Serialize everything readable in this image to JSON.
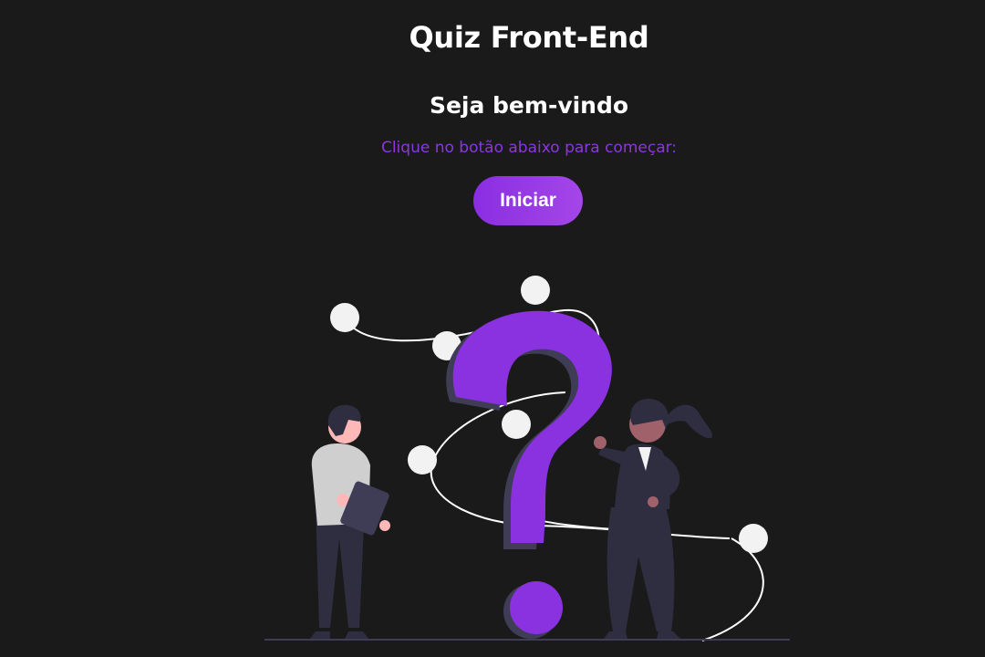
{
  "header": {
    "title": "Quiz Front-End",
    "subtitle": "Seja bem-vindo",
    "instruction": "Clique no botão abaixo para começar:"
  },
  "actions": {
    "start_label": "Iniciar"
  },
  "illustration": {
    "name": "questions-illustration",
    "accent_color": "#8a32e0",
    "figure_color": "#2f2e41"
  },
  "colors": {
    "background": "#1b1a1b",
    "accent": "#8b36e0",
    "text": "#ffffff"
  }
}
